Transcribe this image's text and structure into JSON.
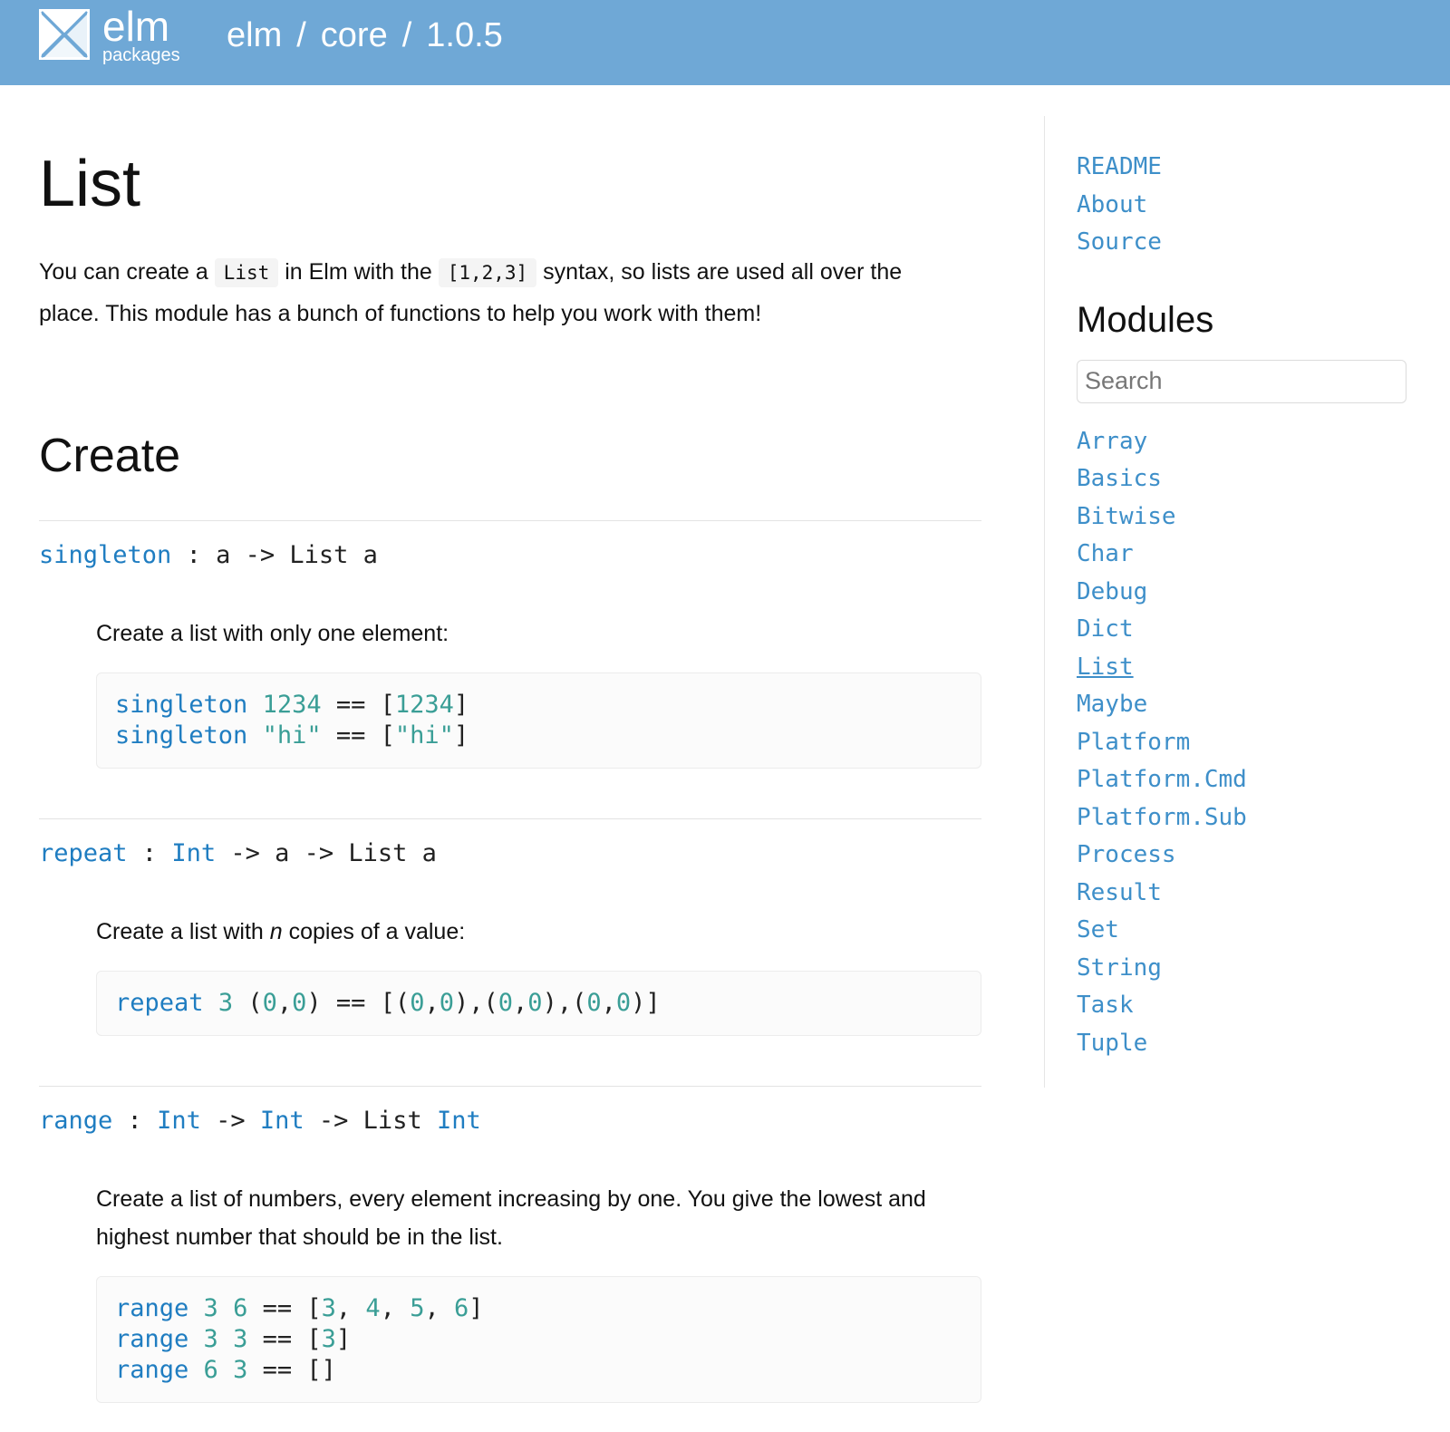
{
  "header": {
    "logo_word": "elm",
    "logo_sub": "packages",
    "crumbs": [
      "elm",
      "core",
      "1.0.5"
    ],
    "separator": "/"
  },
  "page": {
    "title": "List",
    "intro": {
      "t1": "You can create a ",
      "c1": "List",
      "t2": " in Elm with the ",
      "c2": "[1,2,3]",
      "t3": " syntax, so lists are used all over the place. This module has a bunch of functions to help you work with them!"
    },
    "section_title": "Create"
  },
  "entries": [
    {
      "name": "singleton",
      "sig": [
        {
          "t": " : a -> List a",
          "c": "plain"
        }
      ],
      "desc": "Create a list with only one element:",
      "code": [
        [
          {
            "t": "singleton",
            "c": "k"
          },
          {
            "t": " ",
            "c": "p"
          },
          {
            "t": "1234",
            "c": "n"
          },
          {
            "t": " == [",
            "c": "p"
          },
          {
            "t": "1234",
            "c": "n"
          },
          {
            "t": "]",
            "c": "p"
          }
        ],
        [
          {
            "t": "singleton",
            "c": "k"
          },
          {
            "t": " ",
            "c": "p"
          },
          {
            "t": "\"hi\"",
            "c": "s"
          },
          {
            "t": " == [",
            "c": "p"
          },
          {
            "t": "\"hi\"",
            "c": "s"
          },
          {
            "t": "]",
            "c": "p"
          }
        ]
      ]
    },
    {
      "name": "repeat",
      "sig": [
        {
          "t": " : ",
          "c": "plain"
        },
        {
          "t": "Int",
          "c": "ty"
        },
        {
          "t": " -> a -> List a",
          "c": "plain"
        }
      ],
      "desc_parts": {
        "before": "Create a list with ",
        "em": "n",
        "after": " copies of a value:"
      },
      "code": [
        [
          {
            "t": "repeat",
            "c": "k"
          },
          {
            "t": " ",
            "c": "p"
          },
          {
            "t": "3",
            "c": "n"
          },
          {
            "t": " (",
            "c": "p"
          },
          {
            "t": "0",
            "c": "n"
          },
          {
            "t": ",",
            "c": "p"
          },
          {
            "t": "0",
            "c": "n"
          },
          {
            "t": ") == [(",
            "c": "p"
          },
          {
            "t": "0",
            "c": "n"
          },
          {
            "t": ",",
            "c": "p"
          },
          {
            "t": "0",
            "c": "n"
          },
          {
            "t": "),(",
            "c": "p"
          },
          {
            "t": "0",
            "c": "n"
          },
          {
            "t": ",",
            "c": "p"
          },
          {
            "t": "0",
            "c": "n"
          },
          {
            "t": "),(",
            "c": "p"
          },
          {
            "t": "0",
            "c": "n"
          },
          {
            "t": ",",
            "c": "p"
          },
          {
            "t": "0",
            "c": "n"
          },
          {
            "t": ")]",
            "c": "p"
          }
        ]
      ]
    },
    {
      "name": "range",
      "sig": [
        {
          "t": " : ",
          "c": "plain"
        },
        {
          "t": "Int",
          "c": "ty"
        },
        {
          "t": " -> ",
          "c": "plain"
        },
        {
          "t": "Int",
          "c": "ty"
        },
        {
          "t": " -> List ",
          "c": "plain"
        },
        {
          "t": "Int",
          "c": "ty"
        }
      ],
      "desc": "Create a list of numbers, every element increasing by one. You give the lowest and highest number that should be in the list.",
      "code": [
        [
          {
            "t": "range",
            "c": "k"
          },
          {
            "t": " ",
            "c": "p"
          },
          {
            "t": "3",
            "c": "n"
          },
          {
            "t": " ",
            "c": "p"
          },
          {
            "t": "6",
            "c": "n"
          },
          {
            "t": " == [",
            "c": "p"
          },
          {
            "t": "3",
            "c": "n"
          },
          {
            "t": ", ",
            "c": "p"
          },
          {
            "t": "4",
            "c": "n"
          },
          {
            "t": ", ",
            "c": "p"
          },
          {
            "t": "5",
            "c": "n"
          },
          {
            "t": ", ",
            "c": "p"
          },
          {
            "t": "6",
            "c": "n"
          },
          {
            "t": "]",
            "c": "p"
          }
        ],
        [
          {
            "t": "range",
            "c": "k"
          },
          {
            "t": " ",
            "c": "p"
          },
          {
            "t": "3",
            "c": "n"
          },
          {
            "t": " ",
            "c": "p"
          },
          {
            "t": "3",
            "c": "n"
          },
          {
            "t": " == [",
            "c": "p"
          },
          {
            "t": "3",
            "c": "n"
          },
          {
            "t": "]",
            "c": "p"
          }
        ],
        [
          {
            "t": "range",
            "c": "k"
          },
          {
            "t": " ",
            "c": "p"
          },
          {
            "t": "6",
            "c": "n"
          },
          {
            "t": " ",
            "c": "p"
          },
          {
            "t": "3",
            "c": "n"
          },
          {
            "t": " == []",
            "c": "p"
          }
        ]
      ]
    }
  ],
  "sidebar": {
    "links": [
      "README",
      "About",
      "Source"
    ],
    "modules_title": "Modules",
    "search_placeholder": "Search",
    "modules": [
      "Array",
      "Basics",
      "Bitwise",
      "Char",
      "Debug",
      "Dict",
      "List",
      "Maybe",
      "Platform",
      "Platform.Cmd",
      "Platform.Sub",
      "Process",
      "Result",
      "Set",
      "String",
      "Task",
      "Tuple"
    ],
    "active_module": "List"
  },
  "colors": {
    "header_bg": "#6fa8d6",
    "link": "#3e8fc9",
    "function_name": "#1f7dc1",
    "literal": "#3a9e96"
  },
  "icons": {
    "logo": "elm-tangram-logo-icon"
  }
}
